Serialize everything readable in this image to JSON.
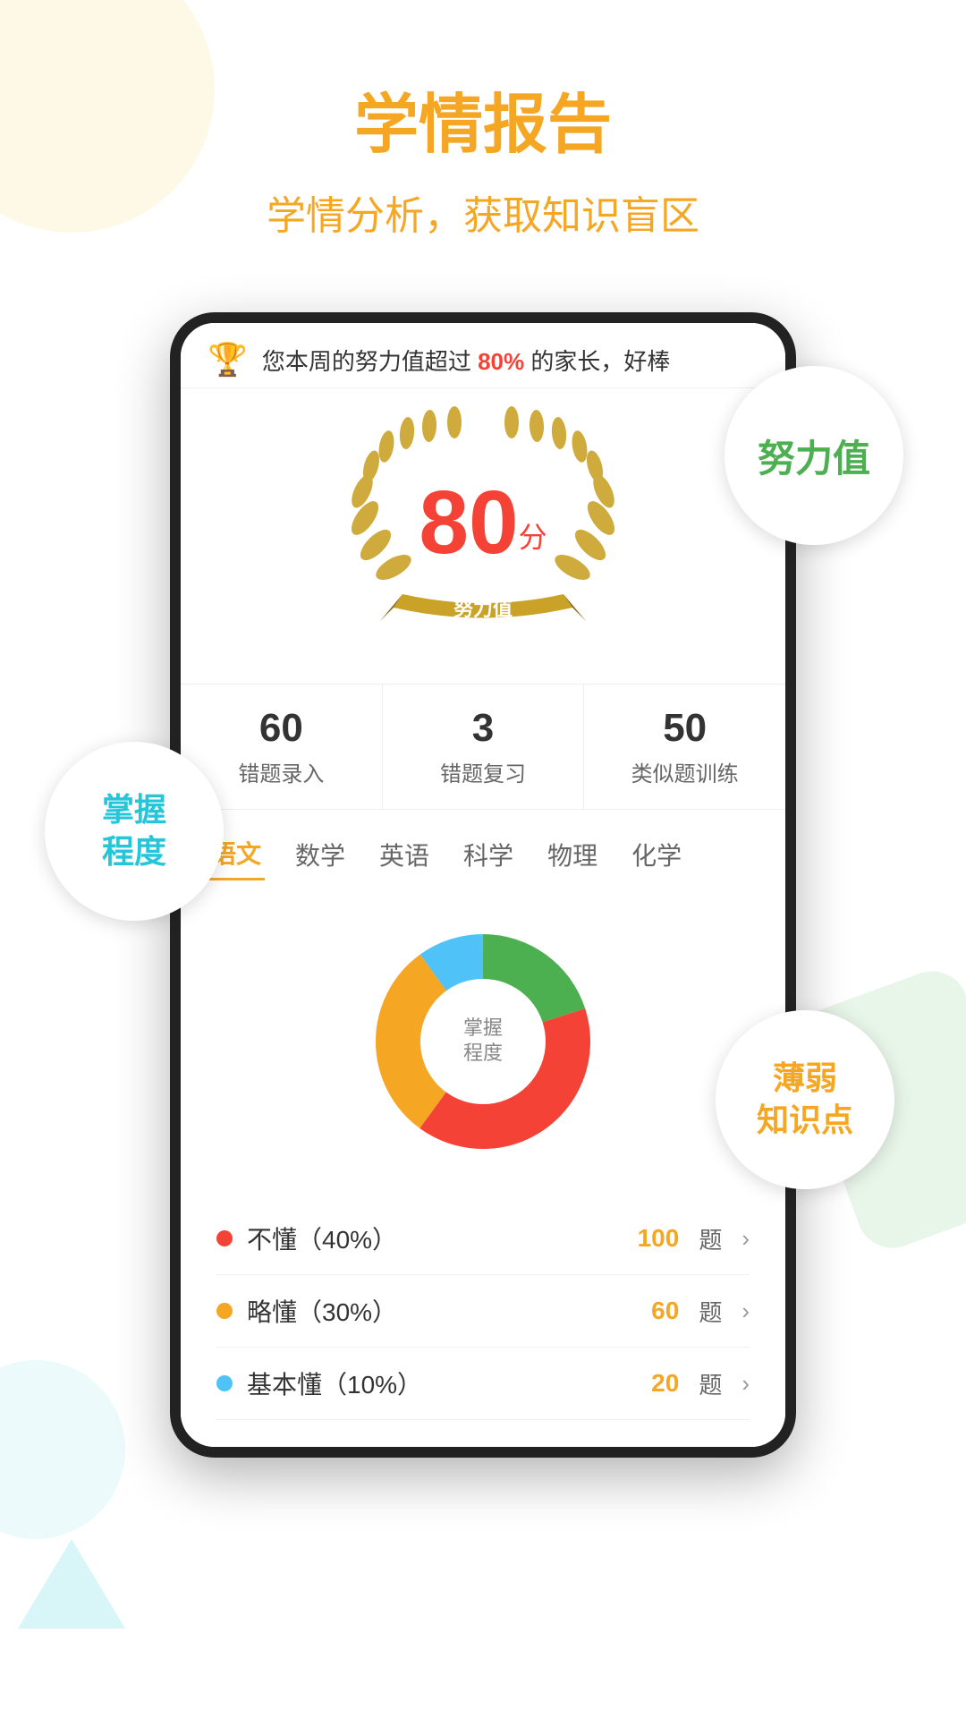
{
  "header": {
    "main_title": "学情报告",
    "subtitle": "学情分析，获取知识盲区"
  },
  "notification": {
    "icon": "🏆",
    "text_before": "您本周的努力值超过",
    "highlight": "80%",
    "text_after": "的家长，好棒"
  },
  "score": {
    "number": "80",
    "unit": "分",
    "label": "努力值"
  },
  "stats": [
    {
      "number": "60",
      "label": "错题录入"
    },
    {
      "number": "3",
      "label": "错题复习"
    },
    {
      "number": "50",
      "label": "类似题训练"
    }
  ],
  "subjects": [
    {
      "label": "语文",
      "active": true
    },
    {
      "label": "数学",
      "active": false
    },
    {
      "label": "英语",
      "active": false
    },
    {
      "label": "科学",
      "active": false
    },
    {
      "label": "物理",
      "active": false
    },
    {
      "label": "化学",
      "active": false
    }
  ],
  "chart": {
    "center_label": "掌握\n程度",
    "segments": [
      {
        "label": "不懂（40%）",
        "color": "#f44336",
        "pct": 40,
        "count": "100",
        "dot_color": "#f44336"
      },
      {
        "label": "略懂（30%）",
        "color": "#f5a623",
        "pct": 30,
        "count": "60",
        "dot_color": "#f5a623"
      },
      {
        "label": "基本懂（10%）",
        "color": "#4fc3f7",
        "pct": 10,
        "count": "20",
        "dot_color": "#4fc3f7"
      }
    ],
    "green_pct": 20
  },
  "float_labels": {
    "effort": "努力值",
    "mastery": "掌握\n程度",
    "weak": "薄弱\n知识点"
  },
  "legend_unit": "题",
  "legend_arrow": ">"
}
